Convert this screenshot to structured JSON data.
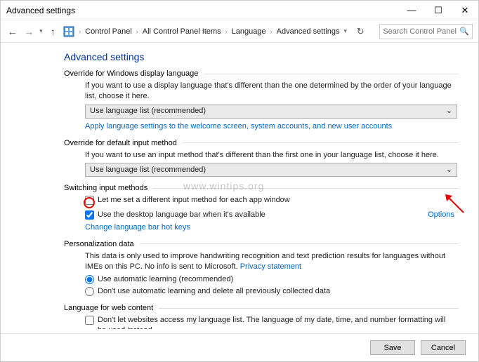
{
  "window": {
    "title": "Advanced settings"
  },
  "breadcrumb": {
    "items": [
      "Control Panel",
      "All Control Panel Items",
      "Language",
      "Advanced settings"
    ]
  },
  "search": {
    "placeholder": "Search Control Panel"
  },
  "page": {
    "title": "Advanced settings"
  },
  "sec1": {
    "head": "Override for Windows display language",
    "text": "If you want to use a display language that's different than the one determined by the order of your language list, choose it here.",
    "dropdown": "Use language list (recommended)",
    "link": "Apply language settings to the welcome screen, system accounts, and new user accounts"
  },
  "sec2": {
    "head": "Override for default input method",
    "text": "If you want to use an input method that's different than the first one in your language list, choose it here.",
    "dropdown": "Use language list (recommended)"
  },
  "sec3": {
    "head": "Switching input methods",
    "cb1": "Let me set a different input method for each app window",
    "cb2": "Use the desktop language bar when it's available",
    "options": "Options",
    "link": "Change language bar hot keys"
  },
  "sec4": {
    "head": "Personalization data",
    "text": "This data is only used to improve handwriting recognition and text prediction results for languages without IMEs on this PC. No info is sent to Microsoft. ",
    "privacy": "Privacy statement",
    "r1": "Use automatic learning (recommended)",
    "r2": "Don't use automatic learning and delete all previously collected data"
  },
  "sec5": {
    "head": "Language for web content",
    "cb": "Don't let websites access my language list. The language of my date, time, and number formatting will be used instead."
  },
  "footer": {
    "save": "Save",
    "cancel": "Cancel"
  },
  "watermark": "www.wintips.org"
}
